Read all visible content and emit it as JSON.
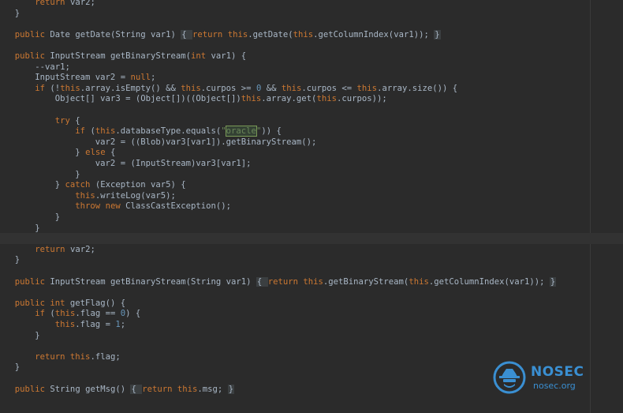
{
  "editor": {
    "lines": [
      [
        {
          "t": "      ",
          "c": "plain"
        },
        {
          "t": "return",
          "c": "kw"
        },
        {
          "t": " var2;",
          "c": "plain"
        }
      ],
      [
        {
          "t": "  }",
          "c": "plain"
        }
      ],
      [],
      [
        {
          "t": "  ",
          "c": "plain"
        },
        {
          "t": "public",
          "c": "kw"
        },
        {
          "t": " Date getDate(String var1) ",
          "c": "plain"
        },
        {
          "t": "{ ",
          "c": "fold"
        },
        {
          "t": "return",
          "c": "kw"
        },
        {
          "t": " ",
          "c": "plain"
        },
        {
          "t": "this",
          "c": "kw"
        },
        {
          "t": ".getDate(",
          "c": "plain"
        },
        {
          "t": "this",
          "c": "kw"
        },
        {
          "t": ".getColumnIndex(var1)); ",
          "c": "plain"
        },
        {
          "t": "}",
          "c": "fold"
        }
      ],
      [],
      [
        {
          "t": "  ",
          "c": "plain"
        },
        {
          "t": "public",
          "c": "kw"
        },
        {
          "t": " InputStream getBinaryStream(",
          "c": "plain"
        },
        {
          "t": "int",
          "c": "kw"
        },
        {
          "t": " var1) {",
          "c": "plain"
        }
      ],
      [
        {
          "t": "      --var1;",
          "c": "plain"
        }
      ],
      [
        {
          "t": "      InputStream var2 = ",
          "c": "plain"
        },
        {
          "t": "null",
          "c": "kw"
        },
        {
          "t": ";",
          "c": "plain"
        }
      ],
      [
        {
          "t": "      ",
          "c": "plain"
        },
        {
          "t": "if",
          "c": "kw"
        },
        {
          "t": " (!",
          "c": "plain"
        },
        {
          "t": "this",
          "c": "kw"
        },
        {
          "t": ".array.isEmpty() && ",
          "c": "plain"
        },
        {
          "t": "this",
          "c": "kw"
        },
        {
          "t": ".curpos >= ",
          "c": "plain"
        },
        {
          "t": "0",
          "c": "num"
        },
        {
          "t": " && ",
          "c": "plain"
        },
        {
          "t": "this",
          "c": "kw"
        },
        {
          "t": ".curpos <= ",
          "c": "plain"
        },
        {
          "t": "this",
          "c": "kw"
        },
        {
          "t": ".array.size()) {",
          "c": "plain"
        }
      ],
      [
        {
          "t": "          Object[] var3 = (Object[])((Object[])",
          "c": "plain"
        },
        {
          "t": "this",
          "c": "kw"
        },
        {
          "t": ".array.get(",
          "c": "plain"
        },
        {
          "t": "this",
          "c": "kw"
        },
        {
          "t": ".curpos));",
          "c": "plain"
        }
      ],
      [],
      [
        {
          "t": "          ",
          "c": "plain"
        },
        {
          "t": "try",
          "c": "kw"
        },
        {
          "t": " {",
          "c": "plain"
        }
      ],
      [
        {
          "t": "              ",
          "c": "plain"
        },
        {
          "t": "if",
          "c": "kw"
        },
        {
          "t": " (",
          "c": "plain"
        },
        {
          "t": "this",
          "c": "kw"
        },
        {
          "t": ".databaseType.equals(",
          "c": "plain"
        },
        {
          "t": "\"",
          "c": "str"
        },
        {
          "t": "oracle",
          "c": "hl"
        },
        {
          "t": "\"",
          "c": "str"
        },
        {
          "t": ")) {",
          "c": "plain"
        }
      ],
      [
        {
          "t": "                  var2 = ((Blob)var3[var1]).getBinaryStream();",
          "c": "plain"
        }
      ],
      [
        {
          "t": "              } ",
          "c": "plain"
        },
        {
          "t": "else",
          "c": "kw"
        },
        {
          "t": " {",
          "c": "plain"
        }
      ],
      [
        {
          "t": "                  var2 = (InputStream)var3[var1];",
          "c": "plain"
        }
      ],
      [
        {
          "t": "              }",
          "c": "plain"
        }
      ],
      [
        {
          "t": "          } ",
          "c": "plain"
        },
        {
          "t": "catch",
          "c": "kw"
        },
        {
          "t": " (Exception var5) {",
          "c": "plain"
        }
      ],
      [
        {
          "t": "              ",
          "c": "plain"
        },
        {
          "t": "this",
          "c": "kw"
        },
        {
          "t": ".writeLog(var5);",
          "c": "plain"
        }
      ],
      [
        {
          "t": "              ",
          "c": "plain"
        },
        {
          "t": "throw new",
          "c": "kw"
        },
        {
          "t": " ClassCastException();",
          "c": "plain"
        }
      ],
      [
        {
          "t": "          }",
          "c": "plain"
        }
      ],
      [
        {
          "t": "      }",
          "c": "plain"
        }
      ],
      [],
      [
        {
          "t": "      ",
          "c": "plain"
        },
        {
          "t": "return",
          "c": "kw"
        },
        {
          "t": " var2;",
          "c": "plain"
        }
      ],
      [
        {
          "t": "  }",
          "c": "plain"
        }
      ],
      [],
      [
        {
          "t": "  ",
          "c": "plain"
        },
        {
          "t": "public",
          "c": "kw"
        },
        {
          "t": " InputStream getBinaryStream(String var1) ",
          "c": "plain"
        },
        {
          "t": "{ ",
          "c": "fold"
        },
        {
          "t": "return",
          "c": "kw"
        },
        {
          "t": " ",
          "c": "plain"
        },
        {
          "t": "this",
          "c": "kw"
        },
        {
          "t": ".getBinaryStream(",
          "c": "plain"
        },
        {
          "t": "this",
          "c": "kw"
        },
        {
          "t": ".getColumnIndex(var1)); ",
          "c": "plain"
        },
        {
          "t": "}",
          "c": "fold"
        }
      ],
      [],
      [
        {
          "t": "  ",
          "c": "plain"
        },
        {
          "t": "public int",
          "c": "kw"
        },
        {
          "t": " getFlag() {",
          "c": "plain"
        }
      ],
      [
        {
          "t": "      ",
          "c": "plain"
        },
        {
          "t": "if",
          "c": "kw"
        },
        {
          "t": " (",
          "c": "plain"
        },
        {
          "t": "this",
          "c": "kw"
        },
        {
          "t": ".flag == ",
          "c": "plain"
        },
        {
          "t": "0",
          "c": "num"
        },
        {
          "t": ") {",
          "c": "plain"
        }
      ],
      [
        {
          "t": "          ",
          "c": "plain"
        },
        {
          "t": "this",
          "c": "kw"
        },
        {
          "t": ".flag = ",
          "c": "plain"
        },
        {
          "t": "1",
          "c": "num"
        },
        {
          "t": ";",
          "c": "plain"
        }
      ],
      [
        {
          "t": "      }",
          "c": "plain"
        }
      ],
      [],
      [
        {
          "t": "      ",
          "c": "plain"
        },
        {
          "t": "return this",
          "c": "kw"
        },
        {
          "t": ".flag;",
          "c": "plain"
        }
      ],
      [
        {
          "t": "  }",
          "c": "plain"
        }
      ],
      [],
      [
        {
          "t": "  ",
          "c": "plain"
        },
        {
          "t": "public",
          "c": "kw"
        },
        {
          "t": " String getMsg() ",
          "c": "plain"
        },
        {
          "t": "{ ",
          "c": "fold"
        },
        {
          "t": "return this",
          "c": "kw"
        },
        {
          "t": ".msg; ",
          "c": "plain"
        },
        {
          "t": "}",
          "c": "fold"
        }
      ]
    ],
    "current_line_index": 22
  },
  "watermark": {
    "brand": "NOSEC",
    "domain": "nosec.org",
    "icon": "spy-hat-icon",
    "color": "#3a8fd2"
  },
  "colors": {
    "background": "#2b2b2b",
    "keyword": "#cc7832",
    "text": "#a9b7c6",
    "string": "#6a8759",
    "number": "#6897bb"
  }
}
